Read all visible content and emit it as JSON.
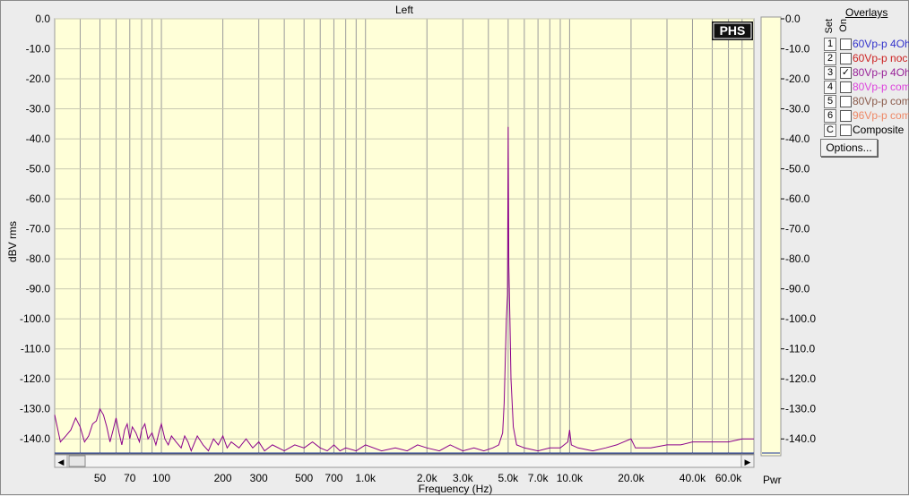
{
  "window": {
    "title": "Left"
  },
  "watermark": "PHS",
  "chart_data": {
    "type": "line",
    "title": "Left",
    "xlabel": "Frequency (Hz)",
    "ylabel": "dBV rms",
    "x_scale": "log",
    "xlim": [
      30,
      80000
    ],
    "ylim": [
      -145,
      0
    ],
    "grid": true,
    "x_tick_labels": [
      "50",
      "70",
      "100",
      "200",
      "300",
      "500",
      "700",
      "1.0k",
      "2.0k",
      "3.0k",
      "5.0k",
      "7.0k",
      "10.0k",
      "20.0k",
      "40.0k",
      "60.0k"
    ],
    "y_tick_labels": [
      "0.0",
      "-10.0",
      "-20.0",
      "-30.0",
      "-40.0",
      "-50.0",
      "-60.0",
      "-70.0",
      "-80.0",
      "-90.0",
      "-100.0",
      "-110.0",
      "-120.0",
      "-130.0",
      "-140.0"
    ],
    "series": [
      {
        "name": "80Vp-p 4Oh",
        "color": "#8b008b",
        "points": [
          [
            30,
            -132
          ],
          [
            32,
            -141
          ],
          [
            34,
            -139
          ],
          [
            36,
            -137
          ],
          [
            38,
            -133
          ],
          [
            40,
            -136
          ],
          [
            42,
            -141
          ],
          [
            44,
            -139
          ],
          [
            46,
            -135
          ],
          [
            48,
            -134
          ],
          [
            50,
            -130
          ],
          [
            52,
            -132
          ],
          [
            54,
            -136
          ],
          [
            56,
            -141
          ],
          [
            58,
            -137
          ],
          [
            60,
            -133
          ],
          [
            62,
            -138
          ],
          [
            64,
            -142
          ],
          [
            66,
            -137
          ],
          [
            68,
            -135
          ],
          [
            70,
            -140
          ],
          [
            72,
            -136
          ],
          [
            75,
            -138
          ],
          [
            78,
            -141
          ],
          [
            80,
            -137
          ],
          [
            83,
            -135
          ],
          [
            86,
            -140
          ],
          [
            90,
            -138
          ],
          [
            94,
            -142
          ],
          [
            98,
            -137
          ],
          [
            100,
            -135
          ],
          [
            104,
            -140
          ],
          [
            108,
            -142
          ],
          [
            112,
            -139
          ],
          [
            118,
            -141
          ],
          [
            125,
            -143
          ],
          [
            130,
            -139
          ],
          [
            135,
            -141
          ],
          [
            140,
            -144
          ],
          [
            150,
            -139
          ],
          [
            160,
            -142
          ],
          [
            170,
            -144
          ],
          [
            180,
            -140
          ],
          [
            190,
            -142
          ],
          [
            200,
            -139
          ],
          [
            210,
            -143
          ],
          [
            220,
            -141
          ],
          [
            240,
            -143
          ],
          [
            260,
            -140
          ],
          [
            280,
            -143
          ],
          [
            300,
            -141
          ],
          [
            320,
            -144
          ],
          [
            350,
            -142
          ],
          [
            400,
            -144
          ],
          [
            450,
            -142
          ],
          [
            500,
            -143
          ],
          [
            550,
            -141
          ],
          [
            600,
            -143
          ],
          [
            650,
            -144
          ],
          [
            700,
            -142
          ],
          [
            750,
            -144
          ],
          [
            800,
            -143
          ],
          [
            900,
            -144
          ],
          [
            1000,
            -142
          ],
          [
            1200,
            -144
          ],
          [
            1400,
            -143
          ],
          [
            1600,
            -144
          ],
          [
            1800,
            -142
          ],
          [
            2000,
            -143
          ],
          [
            2300,
            -144
          ],
          [
            2600,
            -142
          ],
          [
            3000,
            -144
          ],
          [
            3400,
            -143
          ],
          [
            3800,
            -144
          ],
          [
            4200,
            -143
          ],
          [
            4500,
            -142
          ],
          [
            4700,
            -138
          ],
          [
            4780,
            -128
          ],
          [
            4850,
            -112
          ],
          [
            4900,
            -100
          ],
          [
            4960,
            -92
          ],
          [
            5000,
            -36
          ],
          [
            5040,
            -82
          ],
          [
            5100,
            -100
          ],
          [
            5160,
            -120
          ],
          [
            5300,
            -136
          ],
          [
            5500,
            -142
          ],
          [
            6000,
            -143
          ],
          [
            7000,
            -144
          ],
          [
            8000,
            -143
          ],
          [
            9000,
            -143
          ],
          [
            9800,
            -141
          ],
          [
            10000,
            -137
          ],
          [
            10200,
            -142
          ],
          [
            11000,
            -143
          ],
          [
            13000,
            -144
          ],
          [
            15000,
            -143
          ],
          [
            17000,
            -142
          ],
          [
            20000,
            -140
          ],
          [
            21000,
            -143
          ],
          [
            25000,
            -143
          ],
          [
            30000,
            -142
          ],
          [
            35000,
            -142
          ],
          [
            40000,
            -141
          ],
          [
            50000,
            -141
          ],
          [
            60000,
            -141
          ],
          [
            70000,
            -140
          ],
          [
            80000,
            -140
          ]
        ]
      }
    ],
    "pwr": {
      "label": "Pwr",
      "level_dbv": -145
    }
  },
  "overlays": {
    "title": "Overlays",
    "set_header": "Set",
    "on_header": "On",
    "items": [
      {
        "num": "1",
        "checked": false,
        "label": "60Vp-p 4Oh",
        "color": "#3333cc"
      },
      {
        "num": "2",
        "checked": false,
        "label": "60Vp-p noc",
        "color": "#cc2222"
      },
      {
        "num": "3",
        "checked": true,
        "label": "80Vp-p 4Oh",
        "color": "#992299"
      },
      {
        "num": "4",
        "checked": false,
        "label": "80Vp-p com",
        "color": "#dd44dd"
      },
      {
        "num": "5",
        "checked": false,
        "label": "80Vp-p com",
        "color": "#8a5a4a"
      },
      {
        "num": "6",
        "checked": false,
        "label": "96Vp-p com",
        "color": "#ee8866"
      },
      {
        "num": "C",
        "checked": false,
        "label": "Composite",
        "color": "#000000"
      }
    ],
    "options_label": "Options..."
  },
  "scrollbar": {
    "left_arrow": "◀",
    "right_arrow": "▶"
  }
}
